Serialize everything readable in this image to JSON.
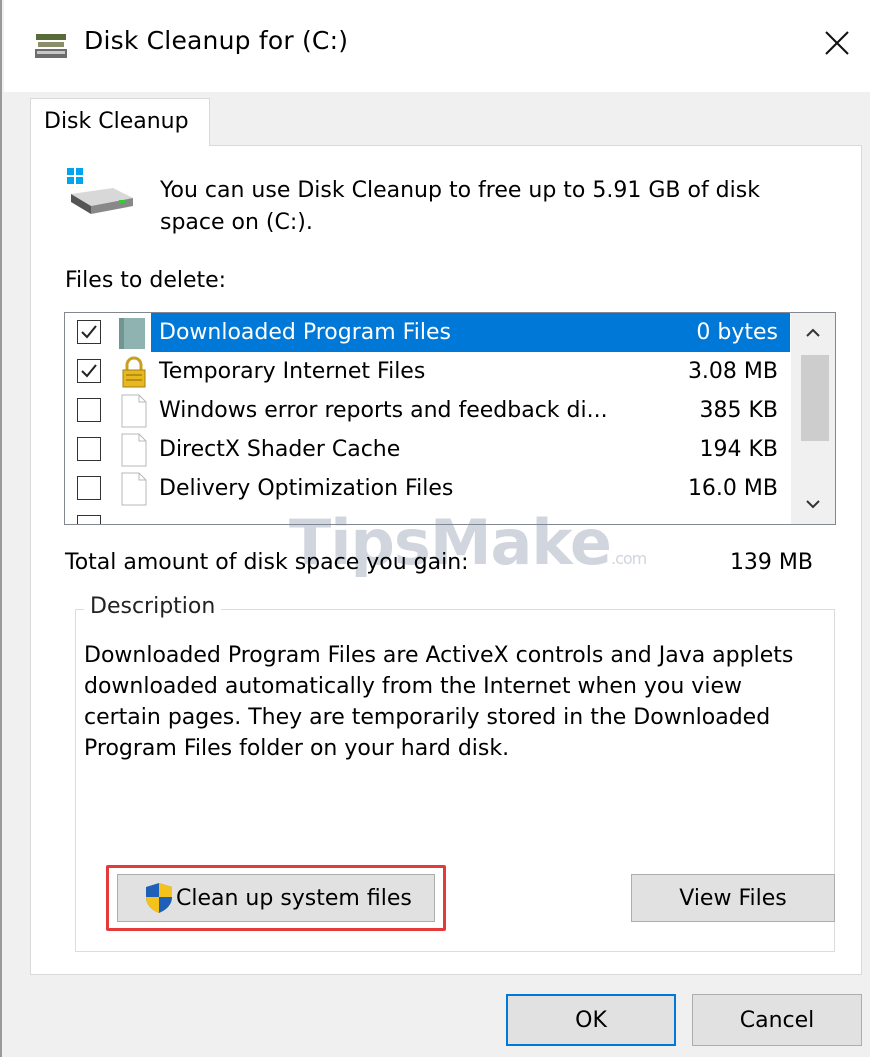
{
  "window": {
    "title": "Disk Cleanup for  (C:)"
  },
  "tab": {
    "label": "Disk Cleanup"
  },
  "intro": {
    "text": "You can use Disk Cleanup to free up to 5.91 GB of disk space on  (C:)."
  },
  "files": {
    "label": "Files to delete:",
    "items": [
      {
        "name": "Downloaded Program Files",
        "size": "0 bytes",
        "checked": true,
        "selected": true,
        "icon": "folder-icon"
      },
      {
        "name": "Temporary Internet Files",
        "size": "3.08 MB",
        "checked": true,
        "selected": false,
        "icon": "lock-icon"
      },
      {
        "name": "Windows error reports and feedback di...",
        "size": "385 KB",
        "checked": false,
        "selected": false,
        "icon": "file-icon"
      },
      {
        "name": "DirectX Shader Cache",
        "size": "194 KB",
        "checked": false,
        "selected": false,
        "icon": "file-icon"
      },
      {
        "name": "Delivery Optimization Files",
        "size": "16.0 MB",
        "checked": false,
        "selected": false,
        "icon": "file-icon"
      }
    ]
  },
  "total": {
    "label": "Total amount of disk space you gain:",
    "value": "139 MB"
  },
  "description": {
    "legend": "Description",
    "text": "Downloaded Program Files are ActiveX controls and Java applets downloaded automatically from the Internet when you view certain pages. They are temporarily stored in the Downloaded Program Files folder on your hard disk."
  },
  "buttons": {
    "cleanup": "Clean up system files",
    "view_files": "View Files",
    "ok": "OK",
    "cancel": "Cancel"
  },
  "watermark": {
    "text": "TipsMake",
    "suffix": ".com"
  },
  "colors": {
    "selection": "#0078d7",
    "highlight": "#e53a3a"
  }
}
